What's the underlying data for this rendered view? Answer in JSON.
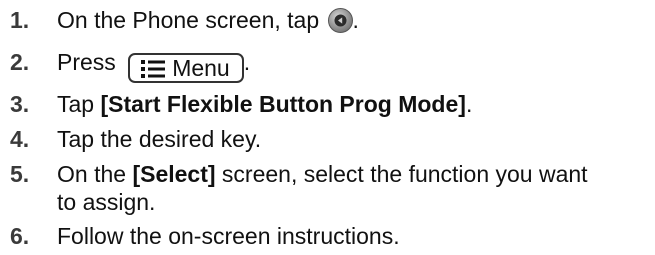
{
  "steps": [
    {
      "number": "1.",
      "text_before": "On the Phone screen, tap ",
      "text_after": ".",
      "icon": "back-circle-icon"
    },
    {
      "number": "2.",
      "text_before": "Press ",
      "button_label": "Menu",
      "button_icon": "menu-list-icon",
      "text_after": "."
    },
    {
      "number": "3.",
      "text_before": "Tap ",
      "bold": "[Start Flexible Button Prog Mode]",
      "text_after": "."
    },
    {
      "number": "4.",
      "text": "Tap the desired key."
    },
    {
      "number": "5.",
      "text_before": "On the ",
      "bold": "[Select]",
      "text_mid": " screen, select the function you want",
      "text_line2": "to assign."
    },
    {
      "number": "6.",
      "text": "Follow the on-screen instructions."
    }
  ]
}
